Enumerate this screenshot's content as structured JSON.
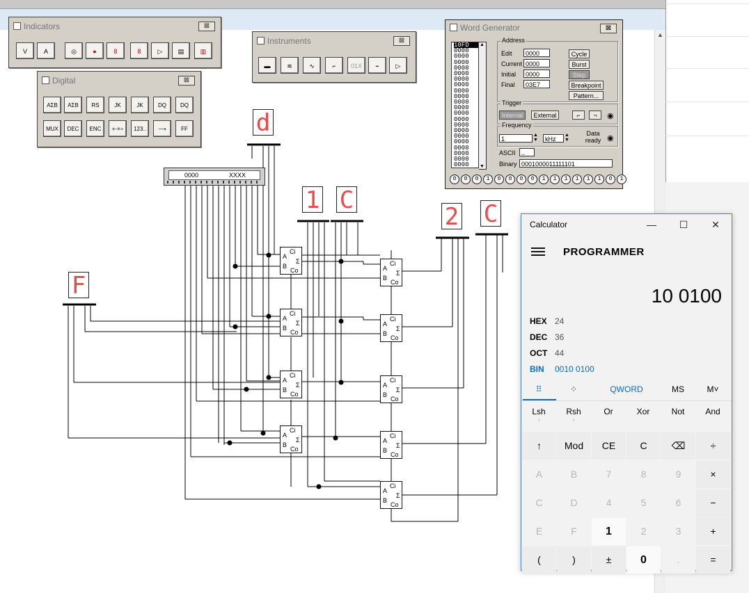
{
  "palettes": {
    "indicators": {
      "title": "Indicators",
      "close": "⊠",
      "buttons": [
        "V",
        "A",
        "◎",
        "●",
        "8",
        "8",
        "▷",
        "▤",
        "▥"
      ]
    },
    "digital": {
      "title": "Digital",
      "close": "⊠",
      "row1": [
        "AΣB",
        "AΣB",
        "RS",
        "JK",
        "JK",
        "DQ",
        "DQ"
      ],
      "row2": [
        "MUX",
        "DEC",
        "ENC",
        "+-×÷",
        "123..",
        "⟶",
        "FF"
      ]
    },
    "instruments": {
      "title": "Instruments",
      "close": "⊠",
      "buttons": [
        "▬",
        "≋",
        "∿",
        "⌐",
        "01X",
        "⌁",
        "▷"
      ]
    }
  },
  "word_generator": {
    "title": "Word Generator",
    "close": "⊠",
    "list": [
      "10FD",
      "0000",
      "0000",
      "0000",
      "0000",
      "0000",
      "0000",
      "0000",
      "0000",
      "0000",
      "0000",
      "0000",
      "0000",
      "0000",
      "0000",
      "0000",
      "0000",
      "0000",
      "0000",
      "0000",
      "0000",
      "0000"
    ],
    "address": {
      "label": "Address",
      "edit_label": "Edit",
      "edit": "0000",
      "current_label": "Current",
      "current": "0000",
      "initial_label": "Initial",
      "initial": "0000",
      "final_label": "Final",
      "final": "03E7"
    },
    "buttons": {
      "cycle": "Cycle",
      "burst": "Burst",
      "step": "Step",
      "breakpoint": "Breakpoint",
      "pattern": "Pattern..."
    },
    "trigger": {
      "label": "Trigger",
      "internal": "Internal",
      "external": "External"
    },
    "frequency": {
      "label": "Frequency",
      "value": "1",
      "unit": "kHz",
      "data_ready": "Data ready"
    },
    "ascii_label": "ASCII",
    "ascii_value": "..",
    "binary_label": "Binary",
    "binary_value": "0001000011111101",
    "bits": [
      "0",
      "0",
      "0",
      "1",
      "0",
      "0",
      "0",
      "0",
      "1",
      "1",
      "1",
      "1",
      "1",
      "1",
      "0",
      "1"
    ]
  },
  "displays": {
    "d": "d",
    "one": "1",
    "c1": "C",
    "two": "2",
    "c2": "C",
    "f": "F"
  },
  "bus": {
    "left": "0000",
    "right": "XXXX"
  },
  "adder": {
    "a": "A",
    "b": "B",
    "ci": "Ci",
    "co": "Co",
    "sigma": "Σ"
  },
  "calculator": {
    "title": "Calculator",
    "minimize": "—",
    "maximize": "☐",
    "close": "✕",
    "mode": "PROGRAMMER",
    "display": "10 0100",
    "radix": [
      {
        "name": "HEX",
        "value": "24"
      },
      {
        "name": "DEC",
        "value": "36"
      },
      {
        "name": "OCT",
        "value": "44"
      },
      {
        "name": "BIN",
        "value": "0010 0100"
      }
    ],
    "tabs": {
      "keypad": "⠿",
      "bitflip": "⁘",
      "word": "QWORD",
      "ms": "MS",
      "mlist": "M˅"
    },
    "ops": [
      "Lsh",
      "Rsh",
      "Or",
      "Xor",
      "Not",
      "And"
    ],
    "keys": [
      [
        "↑",
        "Mod",
        "CE",
        "C",
        "⌫",
        "÷"
      ],
      [
        "A",
        "B",
        "7",
        "8",
        "9",
        "×"
      ],
      [
        "C",
        "D",
        "4",
        "5",
        "6",
        "−"
      ],
      [
        "E",
        "F",
        "1",
        "2",
        "3",
        "+"
      ],
      [
        "(",
        ")",
        "±",
        "0",
        ".",
        "="
      ]
    ]
  }
}
